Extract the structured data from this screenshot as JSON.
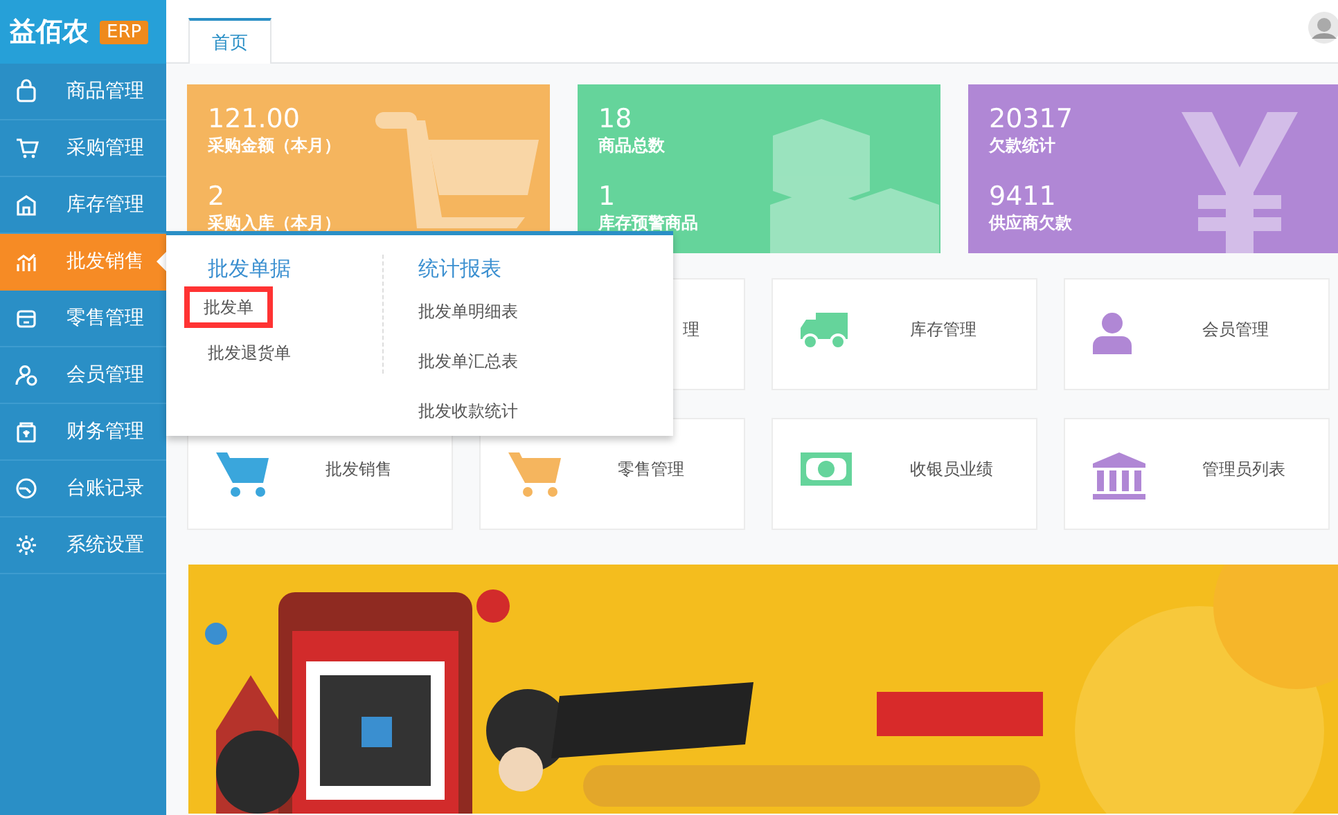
{
  "logo": {
    "name": "益佰农",
    "badge": "ERP"
  },
  "sidebar": {
    "items": [
      {
        "label": "商品管理",
        "selected": false
      },
      {
        "label": "采购管理",
        "selected": false
      },
      {
        "label": "库存管理",
        "selected": false
      },
      {
        "label": "批发销售",
        "selected": true
      },
      {
        "label": "零售管理",
        "selected": false
      },
      {
        "label": "会员管理",
        "selected": false
      },
      {
        "label": "财务管理",
        "selected": false
      },
      {
        "label": "台账记录",
        "selected": false
      },
      {
        "label": "系统设置",
        "selected": false
      }
    ]
  },
  "tabs": [
    {
      "label": "首页",
      "selected": true
    }
  ],
  "stats": [
    {
      "color": "#f5b55e",
      "rows": [
        {
          "value": "121.00",
          "label": "采购金额（本月）"
        },
        {
          "value": "2",
          "label": "采购入库（本月）"
        }
      ]
    },
    {
      "color": "#65d49b",
      "rows": [
        {
          "value": "18",
          "label": "商品总数"
        },
        {
          "value": "1",
          "label": "库存预警商品"
        }
      ]
    },
    {
      "color": "#b087d5",
      "rows": [
        {
          "value": "20317",
          "label": "欠款统计"
        },
        {
          "value": "9411",
          "label": "供应商欠款"
        }
      ]
    }
  ],
  "tiles": [
    {
      "label": "理"
    },
    {
      "label": "库存管理"
    },
    {
      "label": "会员管理"
    },
    {
      "label": "批发销售"
    },
    {
      "label": "零售管理"
    },
    {
      "label": "收银员业绩"
    },
    {
      "label": "管理员列表"
    }
  ],
  "dropdown": {
    "columns": [
      {
        "title": "批发单据",
        "items": [
          {
            "label": "批发单",
            "highlighted": true
          },
          {
            "label": "批发退货单",
            "highlighted": false
          }
        ]
      },
      {
        "title": "统计报表",
        "items": [
          {
            "label": "批发单明细表",
            "highlighted": false
          },
          {
            "label": "批发单汇总表",
            "highlighted": false
          },
          {
            "label": "批发收款统计",
            "highlighted": false
          }
        ]
      }
    ]
  }
}
